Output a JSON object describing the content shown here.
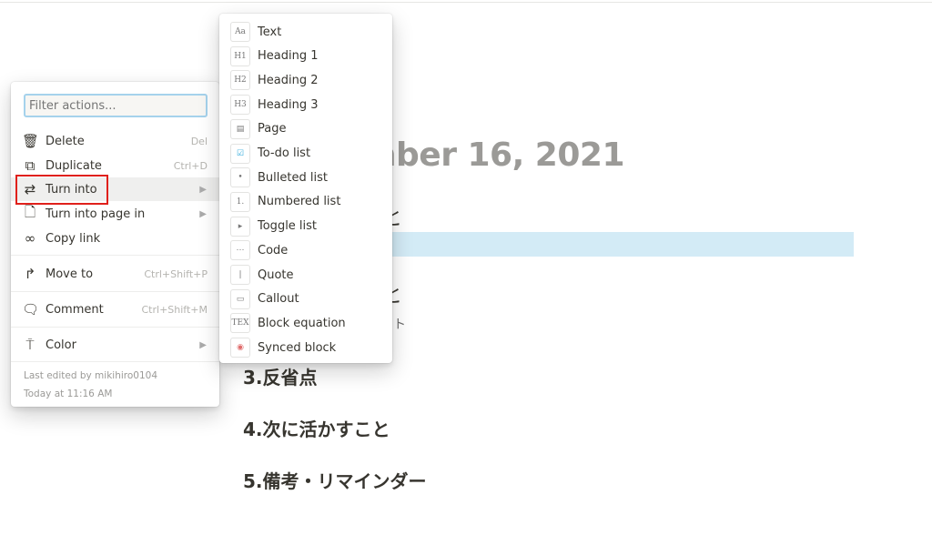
{
  "page": {
    "title": "mber 16, 2021",
    "frag1": "と",
    "frag2": "と",
    "frag3": "ト",
    "headings": [
      "3.反省点",
      "4.次に活かすこと",
      "5.備考・リマインダー"
    ]
  },
  "menu": {
    "filter_placeholder": "Filter actions...",
    "items": [
      {
        "label": "Delete",
        "shortcut": "Del",
        "icon": "trash-icon"
      },
      {
        "label": "Duplicate",
        "shortcut": "Ctrl+D",
        "icon": "duplicate-icon"
      },
      {
        "label": "Turn into",
        "icon": "turn-into-icon",
        "submenu": true,
        "active": true
      },
      {
        "label": "Turn into page in",
        "icon": "page-icon",
        "submenu": true
      },
      {
        "label": "Copy link",
        "icon": "link-icon"
      },
      {
        "label": "Move to",
        "shortcut": "Ctrl+Shift+P",
        "icon": "move-icon"
      },
      {
        "label": "Comment",
        "shortcut": "Ctrl+Shift+M",
        "icon": "comment-icon"
      },
      {
        "label": "Color",
        "icon": "paint-roller-icon",
        "submenu": true
      }
    ],
    "footer": {
      "edited_by": "Last edited by mikihiro0104",
      "edited_at": "Today at 11:16 AM"
    }
  },
  "submenu": {
    "items": [
      {
        "label": "Text",
        "glyph": "Aa"
      },
      {
        "label": "Heading 1",
        "glyph": "H1"
      },
      {
        "label": "Heading 2",
        "glyph": "H2"
      },
      {
        "label": "Heading 3",
        "glyph": "H3"
      },
      {
        "label": "Page",
        "glyph": "▤"
      },
      {
        "label": "To-do list",
        "glyph": "☑"
      },
      {
        "label": "Bulleted list",
        "glyph": "•"
      },
      {
        "label": "Numbered list",
        "glyph": "1."
      },
      {
        "label": "Toggle list",
        "glyph": "▸"
      },
      {
        "label": "Code",
        "glyph": "⋯"
      },
      {
        "label": "Quote",
        "glyph": "❘"
      },
      {
        "label": "Callout",
        "glyph": "▭"
      },
      {
        "label": "Block equation",
        "glyph": "TEX"
      },
      {
        "label": "Synced block",
        "glyph": "◉"
      }
    ]
  },
  "colors": {
    "accent": "#a5d2ec",
    "highlight": "#d3ebf6",
    "annotation": "#e0201b"
  }
}
